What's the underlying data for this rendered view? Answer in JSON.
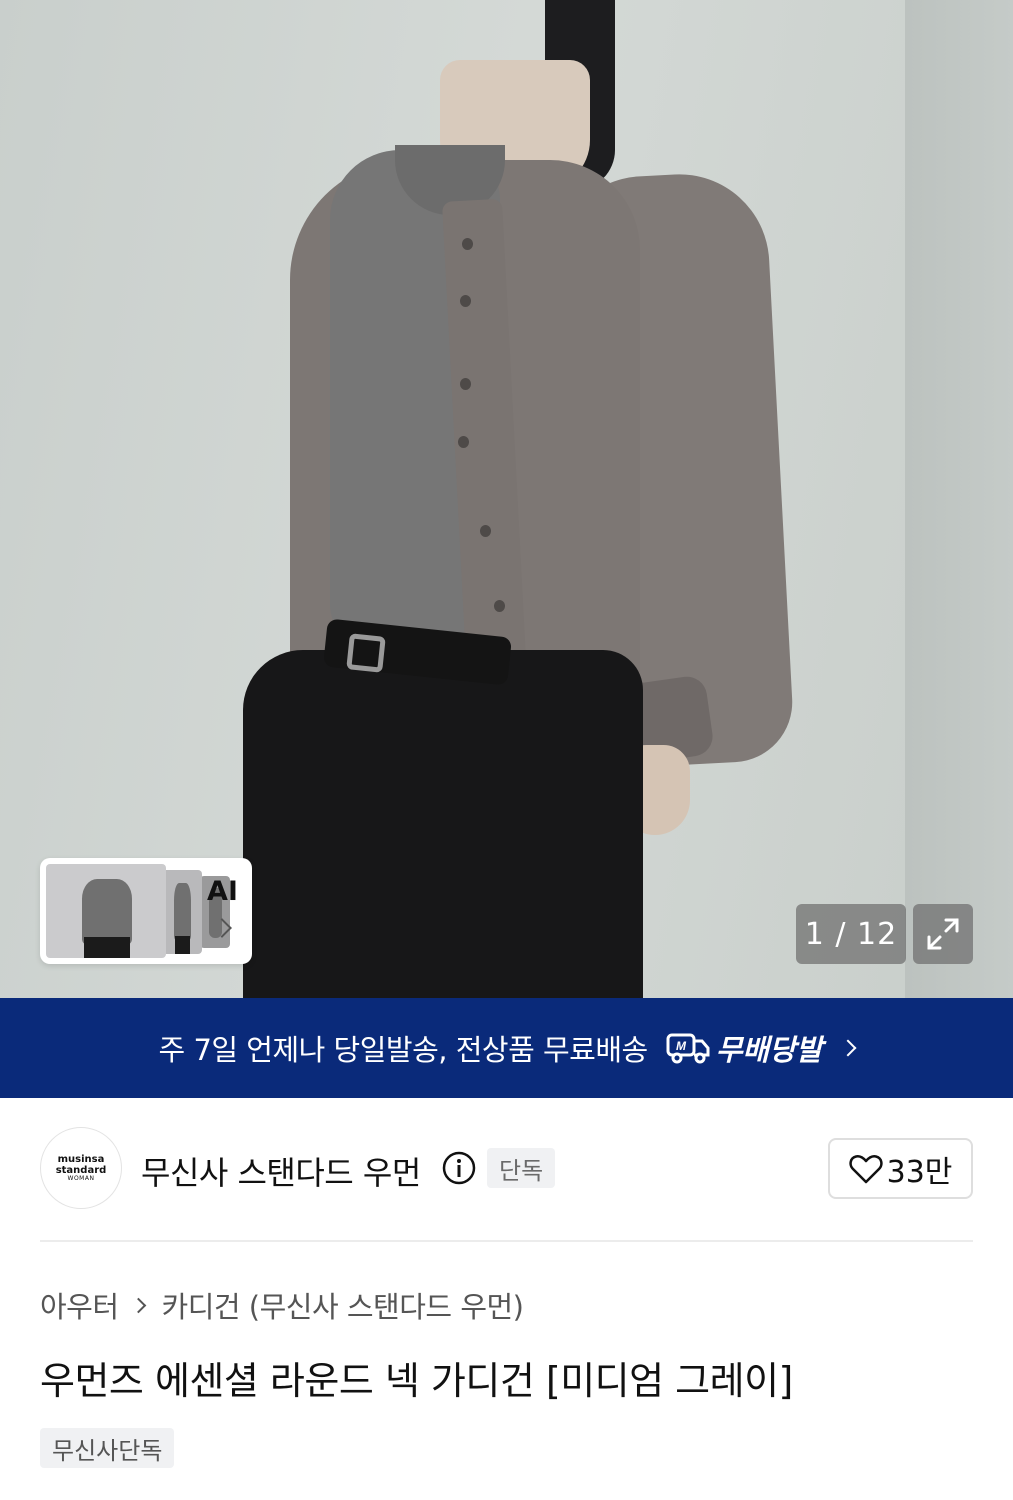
{
  "gallery": {
    "current": "1",
    "separator": "/",
    "total": "12",
    "counter_text": "1 / 12",
    "ai_label": "AI"
  },
  "banner": {
    "text": "주 7일 언제나 당일발송, 전상품 무료배송",
    "brand": "무배당발",
    "color": "#0a2a7a"
  },
  "brand": {
    "logo_line1": "musinsa",
    "logo_line2": "standard",
    "logo_line3": "WOMAN",
    "name": "무신사 스탠다드 우먼",
    "badge": "단독",
    "likes": "33만"
  },
  "breadcrumb": {
    "category": "아우터",
    "subcategory": "카디건 (무신사 스탠다드 우먼)"
  },
  "product": {
    "title": "우먼즈 에센셜 라운드 넥 가디건 [미디엄 그레이]",
    "tag": "무신사단독"
  },
  "icons": {
    "expand": "expand-icon",
    "info": "info-icon",
    "heart": "heart-icon",
    "truck": "delivery-truck-icon",
    "chevron": "chevron-right-icon"
  }
}
